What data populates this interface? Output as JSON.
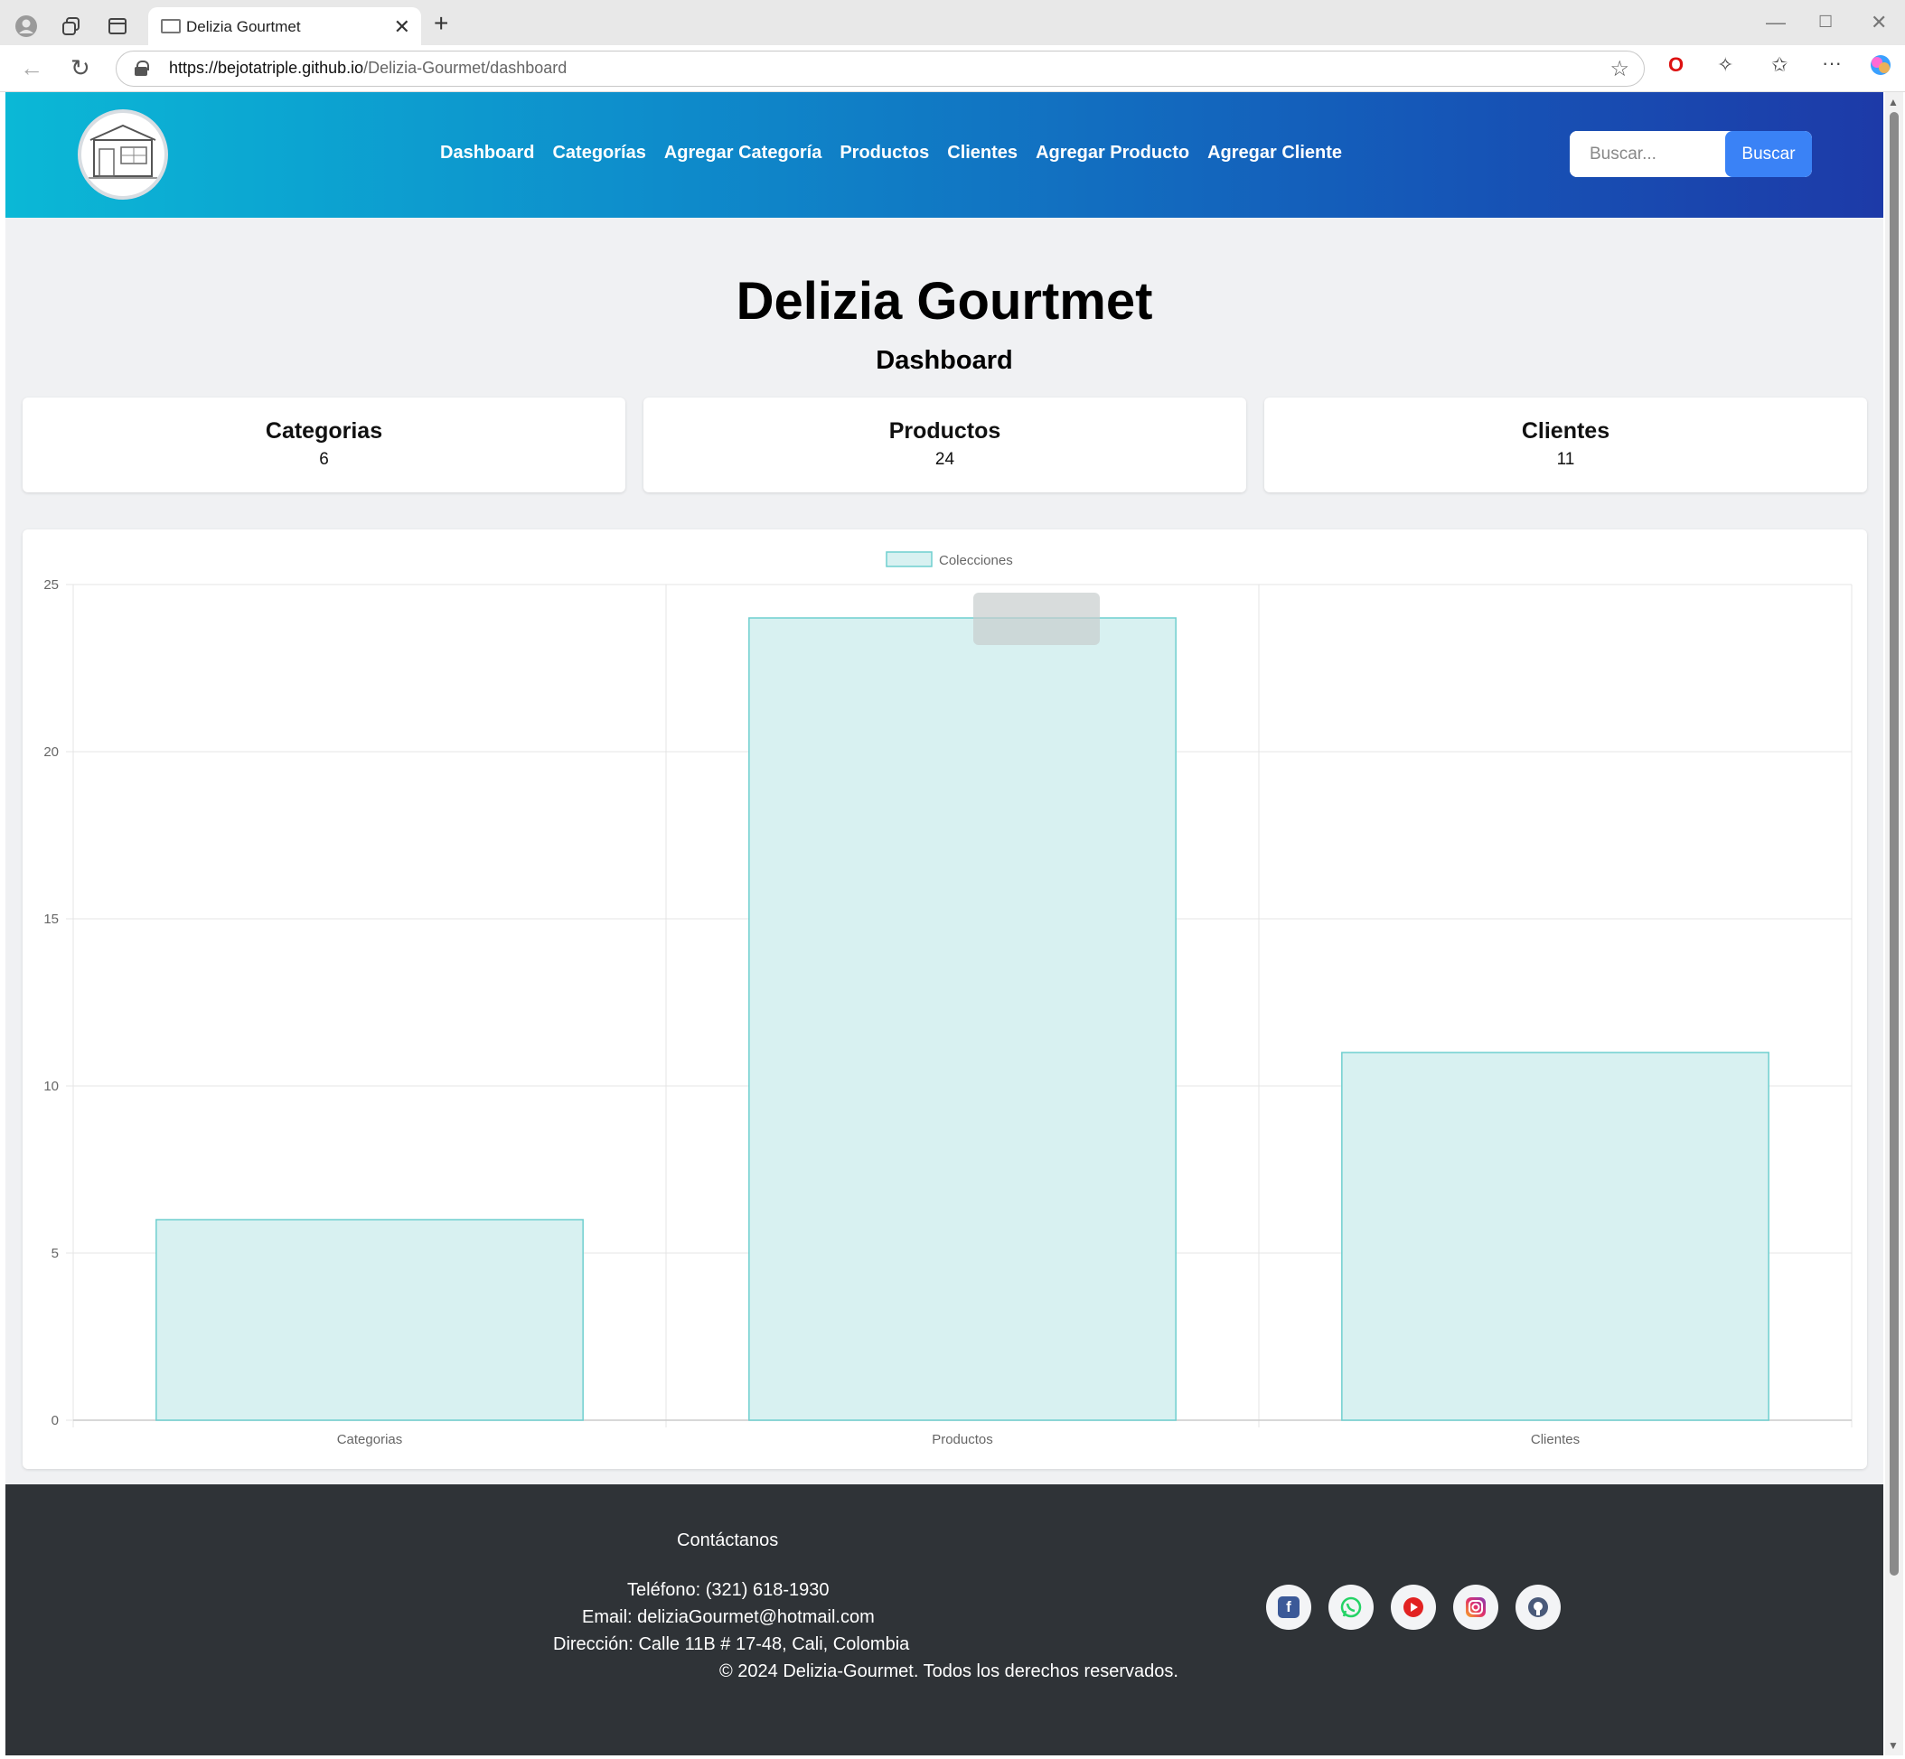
{
  "browser": {
    "tab_title": "Delizia Gourtmet",
    "url_host": "https://bejotatriple.github.io",
    "url_path": "/Delizia-Gourmet/dashboard"
  },
  "navbar": {
    "links": [
      "Dashboard",
      "Categorías",
      "Agregar Categoría",
      "Productos",
      "Clientes",
      "Agregar Producto",
      "Agregar Cliente"
    ],
    "search_placeholder": "Buscar...",
    "search_button": "Buscar"
  },
  "header": {
    "title": "Delizia Gourtmet",
    "subtitle": "Dashboard"
  },
  "cards": [
    {
      "title": "Categorias",
      "value": "6"
    },
    {
      "title": "Productos",
      "value": "24"
    },
    {
      "title": "Clientes",
      "value": "11"
    }
  ],
  "chart_data": {
    "type": "bar",
    "categories": [
      "Categorias",
      "Productos",
      "Clientes"
    ],
    "series": [
      {
        "name": "Colecciones",
        "values": [
          6,
          24,
          11
        ]
      }
    ],
    "ylim": [
      0,
      25
    ],
    "yticks": [
      0,
      5,
      10,
      15,
      20,
      25
    ],
    "grid": true,
    "legend_position": "top",
    "bar_fill": "#d8f1f1",
    "bar_stroke": "#6fcfcf"
  },
  "footer": {
    "contact_title": "Contáctanos",
    "phone": "Teléfono: (321) 618-1930",
    "email": "Email: deliziaGourmet@hotmail.com",
    "address": "Dirección: Calle 11B # 17-48, Cali, Colombia",
    "copyright": "© 2024 Delizia-Gourmet. Todos los derechos reservados.",
    "social": [
      "facebook-icon",
      "whatsapp-icon",
      "youtube-icon",
      "instagram-icon",
      "github-icon"
    ]
  },
  "colors": {
    "navbar_start": "#0bb8d6",
    "navbar_end": "#1d3aa8",
    "search_button": "#3a82f6",
    "footer_bg": "#2f3337"
  }
}
